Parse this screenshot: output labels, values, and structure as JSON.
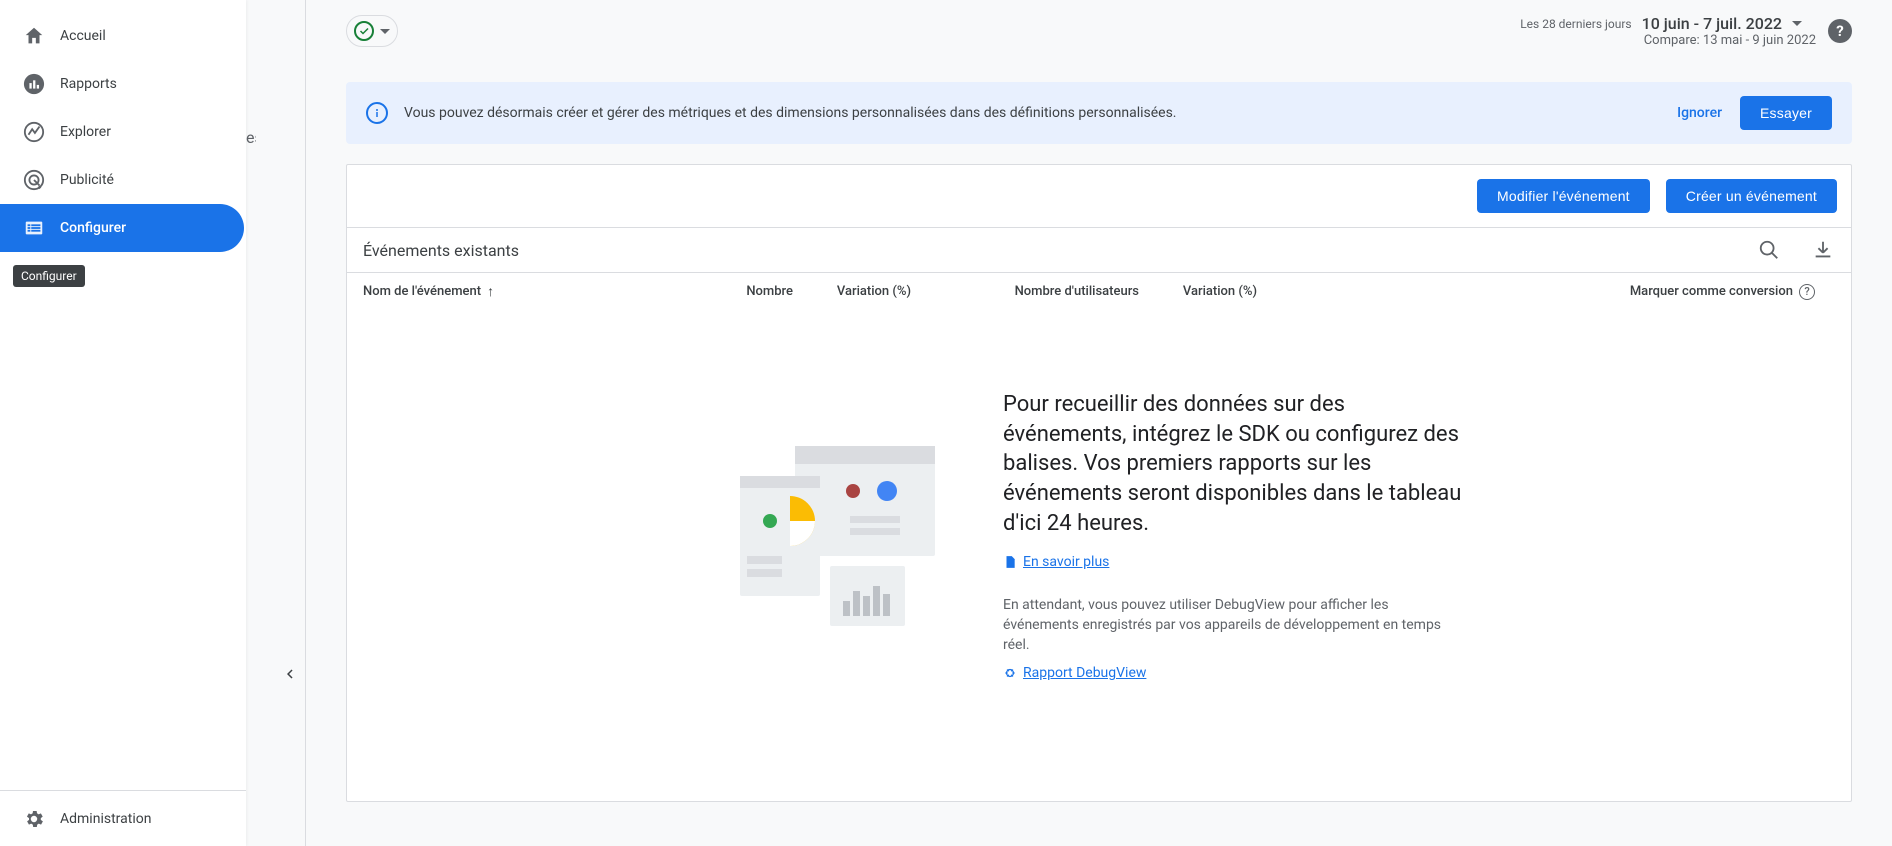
{
  "sidebar": {
    "items": [
      {
        "label": "Accueil",
        "name": "sidebar-item-home"
      },
      {
        "label": "Rapports",
        "name": "sidebar-item-reports"
      },
      {
        "label": "Explorer",
        "name": "sidebar-item-explore"
      },
      {
        "label": "Publicité",
        "name": "sidebar-item-advertising"
      },
      {
        "label": "Configurer",
        "name": "sidebar-item-configure"
      }
    ],
    "admin_label": "Administration",
    "tooltip": "Configurer",
    "secondary_hint": "es"
  },
  "topbar": {
    "date_label": "Les 28 derniers jours",
    "date_range": "10 juin - 7 juil. 2022",
    "compare_label": "Compare: 13 mai - 9 juin 2022"
  },
  "banner": {
    "text": "Vous pouvez désormais créer et gérer des métriques et des dimensions personnalisées dans des définitions personnalisées.",
    "ignore": "Ignorer",
    "try": "Essayer"
  },
  "card": {
    "modify_event": "Modifier l'événement",
    "create_event": "Créer un événement",
    "existing_events": "Événements existants",
    "columns": {
      "name": "Nom de l'événement",
      "count": "Nombre",
      "variation1": "Variation (%)",
      "users": "Nombre d'utilisateurs",
      "variation2": "Variation (%)",
      "mark_conversion": "Marquer comme conversion"
    }
  },
  "empty": {
    "heading": "Pour recueillir des données sur des événements, intégrez le SDK ou configurez des balises. Vos premiers rapports sur les événements seront disponibles dans le tableau d'ici 24 heures.",
    "learn": "En savoir plus",
    "debug_text": "En attendant, vous pouvez utiliser DebugView pour afficher les événements enregistrés par vos appareils de développement en temps réel.",
    "debug_link": "Rapport DebugView"
  }
}
